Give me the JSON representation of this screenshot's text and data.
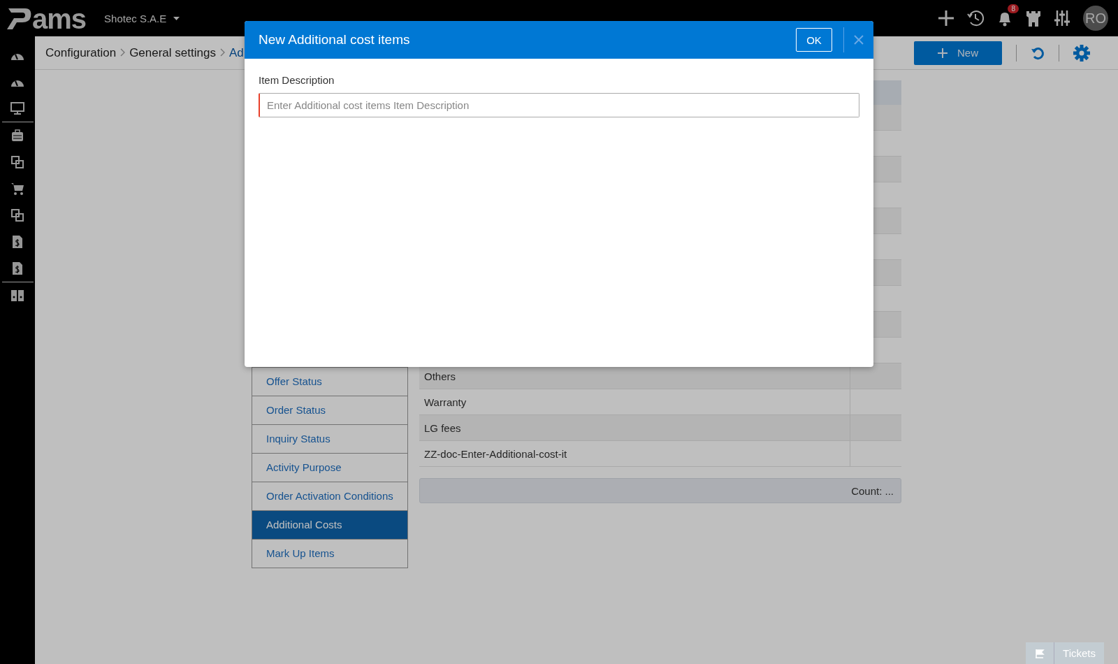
{
  "topbar": {
    "logo_text": "ams",
    "company": "Shotec S.A.E",
    "notification_count": "8",
    "avatar_initials": "RO"
  },
  "breadcrumb": [
    "Configuration",
    "General settings",
    "Ad"
  ],
  "toolbar": {
    "new_button": "New"
  },
  "settings_menu": [
    {
      "label": "Offer Status",
      "selected": false
    },
    {
      "label": "Order Status",
      "selected": false
    },
    {
      "label": "Inquiry Status",
      "selected": false
    },
    {
      "label": "Activity Purpose",
      "selected": false
    },
    {
      "label": "Order Activation Conditions",
      "selected": false
    },
    {
      "label": "Additional Costs",
      "selected": true
    },
    {
      "label": "Mark Up Items",
      "selected": false
    }
  ],
  "table": {
    "rows": [
      "Others",
      "Warranty",
      "LG fees",
      "ZZ-doc-Enter-Additional-cost-it"
    ],
    "footer": "Count: ..."
  },
  "modal": {
    "title": "New Additional cost items",
    "ok_button": "OK",
    "field_label": "Item Description",
    "placeholder": "Enter Additional cost items Item Description",
    "required": true
  },
  "tickets_button": "Tickets"
}
